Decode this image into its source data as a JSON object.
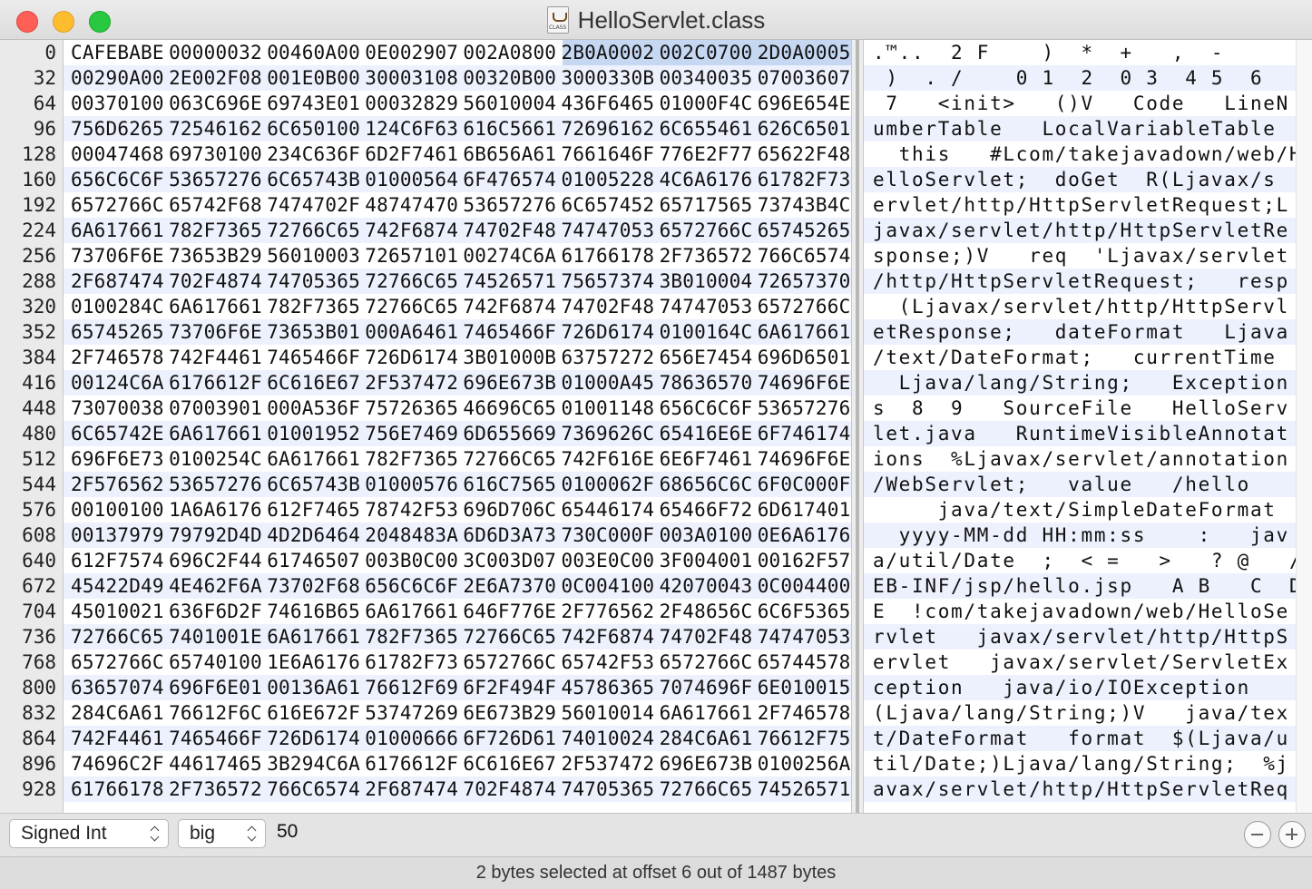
{
  "window": {
    "title": "HelloServlet.class",
    "file_icon_label": "CLASS"
  },
  "selection": {
    "row": 0,
    "word": 1,
    "byte_start": 2,
    "byte_count": 2,
    "ascii_char_start": 6,
    "ascii_char_count": 2
  },
  "rows": [
    {
      "offset": "0",
      "words": [
        "CAFEBABE",
        "00000032",
        "00460A00",
        "0E002907",
        "002A0800",
        "2B0A0002",
        "002C0700",
        "2D0A0005"
      ],
      "ascii": ".™..  2 F    )  *  +   ,  -"
    },
    {
      "offset": "32",
      "words": [
        "00290A00",
        "2E002F08",
        "001E0B00",
        "30003108",
        "00320B00",
        "3000330B",
        "00340035",
        "07003607"
      ],
      "ascii": " )  . /    0 1  2  0 3  4 5  6"
    },
    {
      "offset": "64",
      "words": [
        "00370100",
        "063C696E",
        "69743E01",
        "00032829",
        "56010004",
        "436F6465",
        "01000F4C",
        "696E654E"
      ],
      "ascii": " 7   <init>   ()V   Code   LineN"
    },
    {
      "offset": "96",
      "words": [
        "756D6265",
        "72546162",
        "6C650100",
        "124C6F63",
        "616C5661",
        "72696162",
        "6C655461",
        "626C6501"
      ],
      "ascii": "umberTable   LocalVariableTable"
    },
    {
      "offset": "128",
      "words": [
        "00047468",
        "69730100",
        "234C636F",
        "6D2F7461",
        "6B656A61",
        "7661646F",
        "776E2F77",
        "65622F48"
      ],
      "ascii": "  this   #Lcom/takejavadown/web/H"
    },
    {
      "offset": "160",
      "words": [
        "656C6C6F",
        "53657276",
        "6C65743B",
        "01000564",
        "6F476574",
        "01005228",
        "4C6A6176",
        "61782F73"
      ],
      "ascii": "elloServlet;  doGet  R(Ljavax/s"
    },
    {
      "offset": "192",
      "words": [
        "6572766C",
        "65742F68",
        "7474702F",
        "48747470",
        "53657276",
        "6C657452",
        "65717565",
        "73743B4C"
      ],
      "ascii": "ervlet/http/HttpServletRequest;L"
    },
    {
      "offset": "224",
      "words": [
        "6A617661",
        "782F7365",
        "72766C65",
        "742F6874",
        "74702F48",
        "74747053",
        "6572766C",
        "65745265"
      ],
      "ascii": "javax/servlet/http/HttpServletRe"
    },
    {
      "offset": "256",
      "words": [
        "73706F6E",
        "73653B29",
        "56010003",
        "72657101",
        "00274C6A",
        "61766178",
        "2F736572",
        "766C6574"
      ],
      "ascii": "sponse;)V   req  'Ljavax/servlet"
    },
    {
      "offset": "288",
      "words": [
        "2F687474",
        "702F4874",
        "74705365",
        "72766C65",
        "74526571",
        "75657374",
        "3B010004",
        "72657370"
      ],
      "ascii": "/http/HttpServletRequest;   resp"
    },
    {
      "offset": "320",
      "words": [
        "0100284C",
        "6A617661",
        "782F7365",
        "72766C65",
        "742F6874",
        "74702F48",
        "74747053",
        "6572766C"
      ],
      "ascii": "  (Ljavax/servlet/http/HttpServl"
    },
    {
      "offset": "352",
      "words": [
        "65745265",
        "73706F6E",
        "73653B01",
        "000A6461",
        "7465466F",
        "726D6174",
        "0100164C",
        "6A617661"
      ],
      "ascii": "etResponse;   dateFormat   Ljava"
    },
    {
      "offset": "384",
      "words": [
        "2F746578",
        "742F4461",
        "7465466F",
        "726D6174",
        "3B01000B",
        "63757272",
        "656E7454",
        "696D6501"
      ],
      "ascii": "/text/DateFormat;   currentTime"
    },
    {
      "offset": "416",
      "words": [
        "00124C6A",
        "6176612F",
        "6C616E67",
        "2F537472",
        "696E673B",
        "01000A45",
        "78636570",
        "74696F6E"
      ],
      "ascii": "  Ljava/lang/String;   Exception"
    },
    {
      "offset": "448",
      "words": [
        "73070038",
        "07003901",
        "000A536F",
        "75726365",
        "46696C65",
        "01001148",
        "656C6C6F",
        "53657276"
      ],
      "ascii": "s  8  9   SourceFile   HelloServ"
    },
    {
      "offset": "480",
      "words": [
        "6C65742E",
        "6A617661",
        "01001952",
        "756E7469",
        "6D655669",
        "7369626C",
        "65416E6E",
        "6F746174"
      ],
      "ascii": "let.java   RuntimeVisibleAnnotat"
    },
    {
      "offset": "512",
      "words": [
        "696F6E73",
        "0100254C",
        "6A617661",
        "782F7365",
        "72766C65",
        "742F616E",
        "6E6F7461",
        "74696F6E"
      ],
      "ascii": "ions  %Ljavax/servlet/annotation"
    },
    {
      "offset": "544",
      "words": [
        "2F576562",
        "53657276",
        "6C65743B",
        "01000576",
        "616C7565",
        "0100062F",
        "68656C6C",
        "6F0C000F"
      ],
      "ascii": "/WebServlet;   value   /hello"
    },
    {
      "offset": "576",
      "words": [
        "00100100",
        "1A6A6176",
        "612F7465",
        "78742F53",
        "696D706C",
        "65446174",
        "65466F72",
        "6D617401"
      ],
      "ascii": "     java/text/SimpleDateFormat"
    },
    {
      "offset": "608",
      "words": [
        "00137979",
        "79792D4D",
        "4D2D6464",
        "2048483A",
        "6D6D3A73",
        "730C000F",
        "003A0100",
        "0E6A6176"
      ],
      "ascii": "  yyyy-MM-dd HH:mm:ss    :   jav"
    },
    {
      "offset": "640",
      "words": [
        "612F7574",
        "696C2F44",
        "61746507",
        "003B0C00",
        "3C003D07",
        "003E0C00",
        "3F004001",
        "00162F57"
      ],
      "ascii": "a/util/Date  ;  < =   >   ? @   /W"
    },
    {
      "offset": "672",
      "words": [
        "45422D49",
        "4E462F6A",
        "73702F68",
        "656C6C6F",
        "2E6A7370",
        "0C004100",
        "42070043",
        "0C004400"
      ],
      "ascii": "EB-INF/jsp/hello.jsp   A B   C  D"
    },
    {
      "offset": "704",
      "words": [
        "45010021",
        "636F6D2F",
        "74616B65",
        "6A617661",
        "646F776E",
        "2F776562",
        "2F48656C",
        "6C6F5365"
      ],
      "ascii": "E  !com/takejavadown/web/HelloSe"
    },
    {
      "offset": "736",
      "words": [
        "72766C65",
        "7401001E",
        "6A617661",
        "782F7365",
        "72766C65",
        "742F6874",
        "74702F48",
        "74747053"
      ],
      "ascii": "rvlet   javax/servlet/http/HttpS"
    },
    {
      "offset": "768",
      "words": [
        "6572766C",
        "65740100",
        "1E6A6176",
        "61782F73",
        "6572766C",
        "65742F53",
        "6572766C",
        "65744578"
      ],
      "ascii": "ervlet   javax/servlet/ServletEx"
    },
    {
      "offset": "800",
      "words": [
        "63657074",
        "696F6E01",
        "00136A61",
        "76612F69",
        "6F2F494F",
        "45786365",
        "7074696F",
        "6E010015"
      ],
      "ascii": "ception   java/io/IOException"
    },
    {
      "offset": "832",
      "words": [
        "284C6A61",
        "76612F6C",
        "616E672F",
        "53747269",
        "6E673B29",
        "56010014",
        "6A617661",
        "2F746578"
      ],
      "ascii": "(Ljava/lang/String;)V   java/tex"
    },
    {
      "offset": "864",
      "words": [
        "742F4461",
        "7465466F",
        "726D6174",
        "01000666",
        "6F726D61",
        "74010024",
        "284C6A61",
        "76612F75"
      ],
      "ascii": "t/DateFormat   format  $(Ljava/u"
    },
    {
      "offset": "896",
      "words": [
        "74696C2F",
        "44617465",
        "3B294C6A",
        "6176612F",
        "6C616E67",
        "2F537472",
        "696E673B",
        "0100256A"
      ],
      "ascii": "til/Date;)Ljava/lang/String;  %j"
    },
    {
      "offset": "928",
      "words": [
        "61766178",
        "2F736572",
        "766C6574",
        "2F687474",
        "702F4874",
        "74705365",
        "72766C65",
        "74526571"
      ],
      "ascii": "avax/servlet/http/HttpServletReq"
    }
  ],
  "inspector": {
    "type_options_selected": "Signed Int",
    "endian_selected": "big",
    "value": "50",
    "remove_label": "remove",
    "add_label": "add"
  },
  "status": {
    "text": "2 bytes selected at offset 6 out of 1487 bytes"
  }
}
